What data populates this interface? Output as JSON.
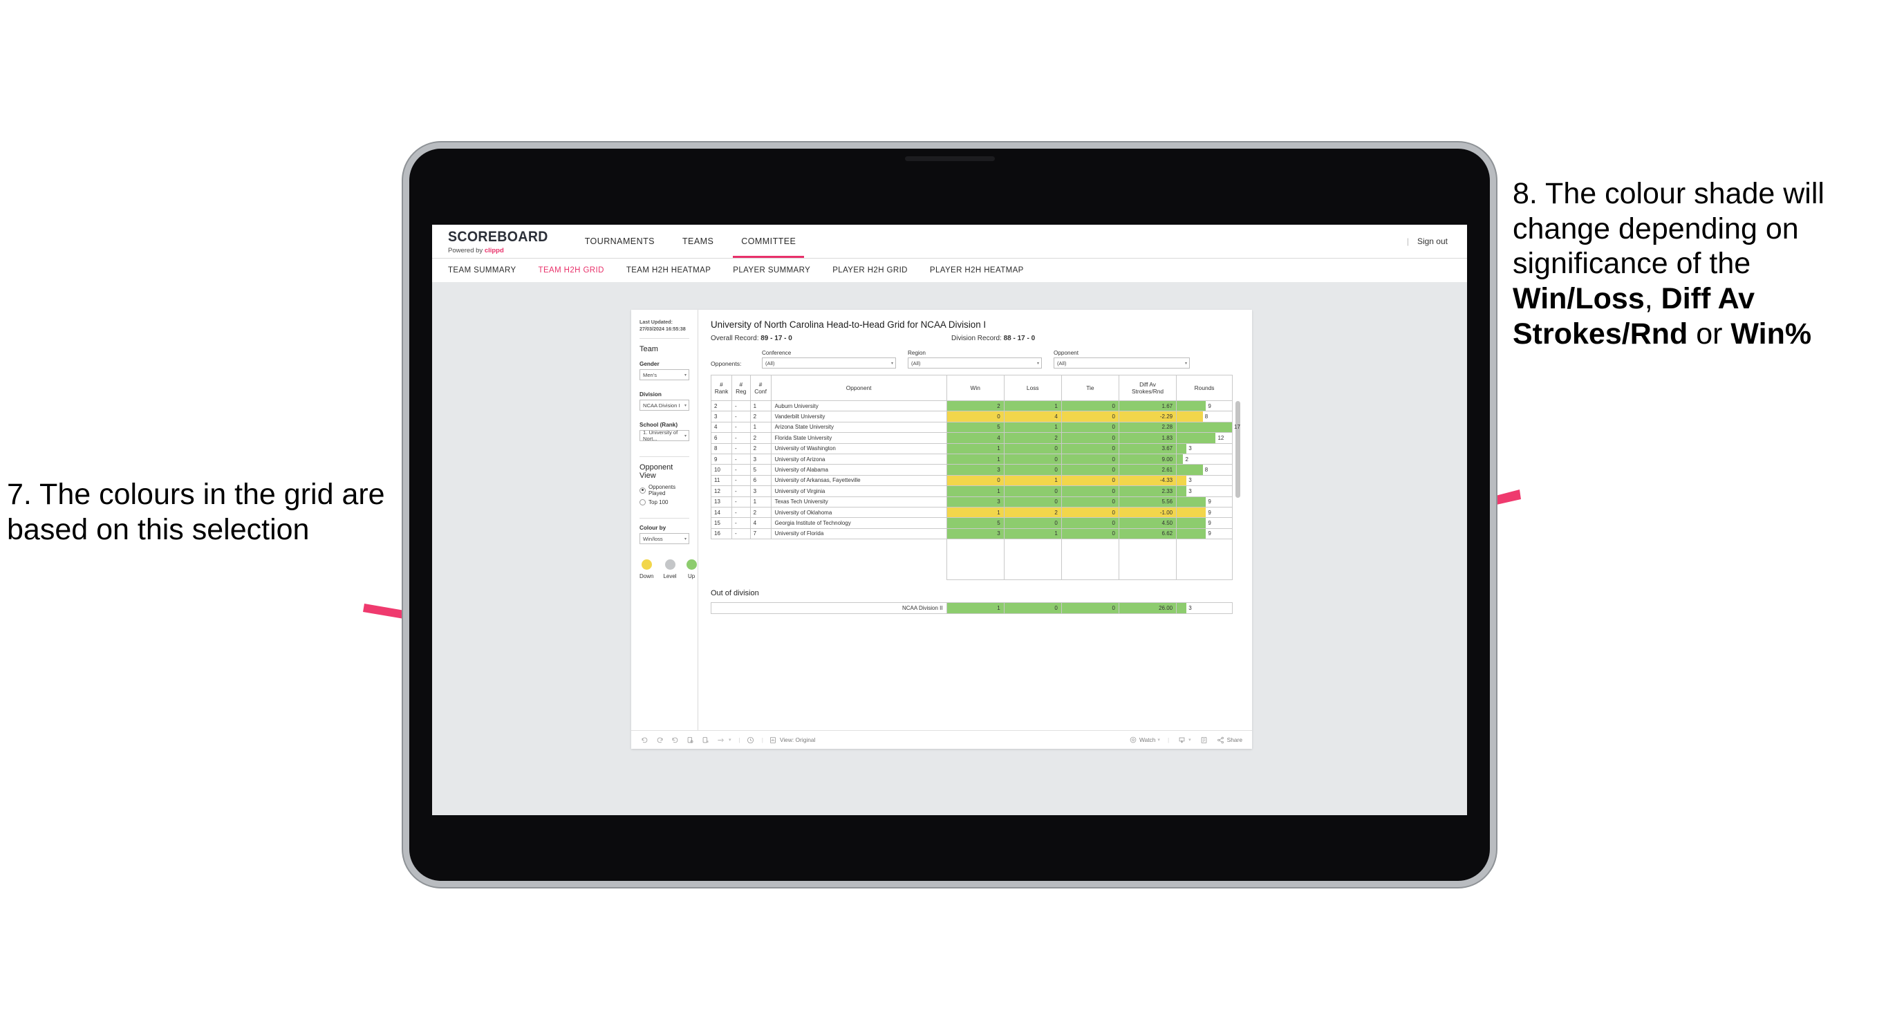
{
  "annotations": {
    "left": {
      "number": "7.",
      "text": "The colours in the grid are based on this selection"
    },
    "right": {
      "number": "8.",
      "prefix": "The colour shade will change depending on significance of the ",
      "bold1": "Win/Loss",
      "mid1": ", ",
      "bold2": "Diff Av Strokes/Rnd",
      "mid2": " or ",
      "bold3": "Win%"
    },
    "accent_color": "#ef3a6e"
  },
  "app": {
    "brand": {
      "title": "SCOREBOARD",
      "powered_prefix": "Powered by ",
      "powered_brand": "clippd"
    },
    "topnav": [
      {
        "label": "TOURNAMENTS",
        "active": false
      },
      {
        "label": "TEAMS",
        "active": false
      },
      {
        "label": "COMMITTEE",
        "active": true
      }
    ],
    "signout": {
      "divider": "|",
      "label": "Sign out"
    },
    "subnav": [
      {
        "label": "TEAM SUMMARY",
        "active": false
      },
      {
        "label": "TEAM H2H GRID",
        "active": true
      },
      {
        "label": "TEAM H2H HEATMAP",
        "active": false
      },
      {
        "label": "PLAYER SUMMARY",
        "active": false
      },
      {
        "label": "PLAYER H2H GRID",
        "active": false
      },
      {
        "label": "PLAYER H2H HEATMAP",
        "active": false
      }
    ],
    "accent": "#e8316a"
  },
  "sidebar": {
    "last_updated": "Last Updated: 27/03/2024 16:55:38",
    "team_heading": "Team",
    "gender": {
      "label": "Gender",
      "value": "Men's"
    },
    "division": {
      "label": "Division",
      "value": "NCAA Division I"
    },
    "school": {
      "label": "School (Rank)",
      "value": "1. University of Nort..."
    },
    "opponent_view": {
      "heading": "Opponent View",
      "options": [
        {
          "label": "Opponents Played",
          "selected": true
        },
        {
          "label": "Top 100",
          "selected": false
        }
      ]
    },
    "colour_by": {
      "label": "Colour by",
      "value": "Win/loss"
    },
    "legend": [
      {
        "label": "Down",
        "color": "#f2d64b"
      },
      {
        "label": "Level",
        "color": "#c4c6c8"
      },
      {
        "label": "Up",
        "color": "#8dcc6e"
      }
    ]
  },
  "viz": {
    "title": "University of North Carolina Head-to-Head Grid for NCAA Division I",
    "overall_record_label": "Overall Record:",
    "overall_record_value": "89 - 17 - 0",
    "division_record_label": "Division Record:",
    "division_record_value": "88 - 17 - 0",
    "opponents_label": "Opponents:",
    "filters": [
      {
        "label": "Conference",
        "value": "(All)"
      },
      {
        "label": "Region",
        "value": "(All)"
      },
      {
        "label": "Opponent",
        "value": "(All)"
      }
    ],
    "out_of_division_heading": "Out of division"
  },
  "toolbar": {
    "view_label": "View: Original",
    "watch_label": "Watch",
    "share_label": "Share"
  },
  "chart_data": {
    "type": "table",
    "title": "University of North Carolina Head-to-Head Grid for NCAA Division I",
    "columns": [
      "# Rank",
      "# Reg",
      "# Conf",
      "Opponent",
      "Win",
      "Loss",
      "Tie",
      "Diff Av Strokes/Rnd",
      "Rounds"
    ],
    "column_header_lines": [
      [
        "#",
        "Rank"
      ],
      [
        "#",
        "Reg"
      ],
      [
        "#",
        "Conf"
      ],
      [
        "Opponent"
      ],
      [
        "Win"
      ],
      [
        "Loss"
      ],
      [
        "Tie"
      ],
      [
        "Diff Av",
        "Strokes/Rnd"
      ],
      [
        "Rounds"
      ]
    ],
    "rounds_max": 17,
    "rows": [
      {
        "rank": "2",
        "reg": "-",
        "conf": "1",
        "opponent": "Auburn University",
        "win": "2",
        "loss": "1",
        "tie": "0",
        "diff": "1.67",
        "rounds": "9",
        "rounds_val": 9,
        "state": "up"
      },
      {
        "rank": "3",
        "reg": "-",
        "conf": "2",
        "opponent": "Vanderbilt University",
        "win": "0",
        "loss": "4",
        "tie": "0",
        "diff": "-2.29",
        "rounds": "8",
        "rounds_val": 8,
        "state": "down"
      },
      {
        "rank": "4",
        "reg": "-",
        "conf": "1",
        "opponent": "Arizona State University",
        "win": "5",
        "loss": "1",
        "tie": "0",
        "diff": "2.28",
        "rounds": "17",
        "rounds_val": 17,
        "state": "up"
      },
      {
        "rank": "6",
        "reg": "-",
        "conf": "2",
        "opponent": "Florida State University",
        "win": "4",
        "loss": "2",
        "tie": "0",
        "diff": "1.83",
        "rounds": "12",
        "rounds_val": 12,
        "state": "up"
      },
      {
        "rank": "8",
        "reg": "-",
        "conf": "2",
        "opponent": "University of Washington",
        "win": "1",
        "loss": "0",
        "tie": "0",
        "diff": "3.67",
        "rounds": "3",
        "rounds_val": 3,
        "state": "up"
      },
      {
        "rank": "9",
        "reg": "-",
        "conf": "3",
        "opponent": "University of Arizona",
        "win": "1",
        "loss": "0",
        "tie": "0",
        "diff": "9.00",
        "rounds": "2",
        "rounds_val": 2,
        "state": "up"
      },
      {
        "rank": "10",
        "reg": "-",
        "conf": "5",
        "opponent": "University of Alabama",
        "win": "3",
        "loss": "0",
        "tie": "0",
        "diff": "2.61",
        "rounds": "8",
        "rounds_val": 8,
        "state": "up"
      },
      {
        "rank": "11",
        "reg": "-",
        "conf": "6",
        "opponent": "University of Arkansas, Fayetteville",
        "win": "0",
        "loss": "1",
        "tie": "0",
        "diff": "-4.33",
        "rounds": "3",
        "rounds_val": 3,
        "state": "down"
      },
      {
        "rank": "12",
        "reg": "-",
        "conf": "3",
        "opponent": "University of Virginia",
        "win": "1",
        "loss": "0",
        "tie": "0",
        "diff": "2.33",
        "rounds": "3",
        "rounds_val": 3,
        "state": "up"
      },
      {
        "rank": "13",
        "reg": "-",
        "conf": "1",
        "opponent": "Texas Tech University",
        "win": "3",
        "loss": "0",
        "tie": "0",
        "diff": "5.56",
        "rounds": "9",
        "rounds_val": 9,
        "state": "up"
      },
      {
        "rank": "14",
        "reg": "-",
        "conf": "2",
        "opponent": "University of Oklahoma",
        "win": "1",
        "loss": "2",
        "tie": "0",
        "diff": "-1.00",
        "rounds": "9",
        "rounds_val": 9,
        "state": "down"
      },
      {
        "rank": "15",
        "reg": "-",
        "conf": "4",
        "opponent": "Georgia Institute of Technology",
        "win": "5",
        "loss": "0",
        "tie": "0",
        "diff": "4.50",
        "rounds": "9",
        "rounds_val": 9,
        "state": "up"
      },
      {
        "rank": "16",
        "reg": "-",
        "conf": "7",
        "opponent": "University of Florida",
        "win": "3",
        "loss": "1",
        "tie": "0",
        "diff": "6.62",
        "rounds": "9",
        "rounds_val": 9,
        "state": "up"
      }
    ],
    "out_of_division": [
      {
        "label": "NCAA Division II",
        "win": "1",
        "loss": "0",
        "tie": "0",
        "diff": "26.00",
        "rounds": "3",
        "rounds_val": 3,
        "state": "up"
      }
    ],
    "colors": {
      "up": "#8dcc6e",
      "down": "#f2d64b",
      "level": "#c4c6c8"
    }
  }
}
